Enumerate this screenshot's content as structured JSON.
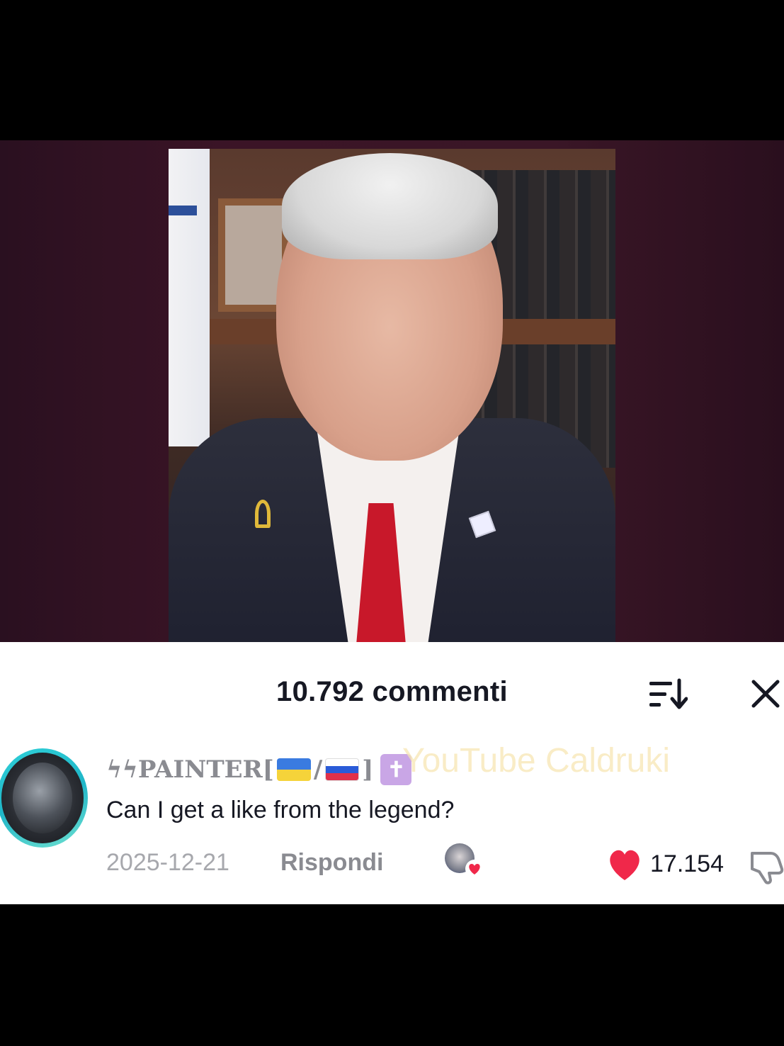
{
  "comments_panel": {
    "title": "10.792 commenti",
    "sort_icon": "sort-icon",
    "close_icon": "close-icon"
  },
  "comment": {
    "username": "ϟϟPAINTER[",
    "username_sep": "/",
    "username_end": "]",
    "cross_glyph": "✝",
    "watermark": "YouTube Caldruki",
    "text": "Can I get a like from the legend?",
    "date": "2025-12-21",
    "reply_label": "Rispondi",
    "like_count": "17.154",
    "liked_by_creator": true
  },
  "colors": {
    "heart": "#f0284a",
    "avatar_ring": "#2fd0d8",
    "title_text": "#161823",
    "muted_text": "#a7a8ad"
  }
}
